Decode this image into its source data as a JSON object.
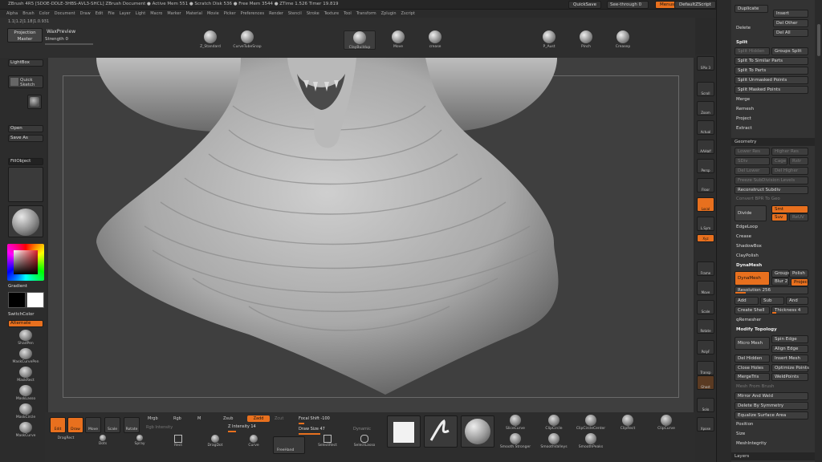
{
  "titlebar": {
    "title": "ZBrush 4R5 [SDOE-DDLE-3HBS-AVL3-SHCL]   ZBrush Document    ● Active Mem 551 ● Scratch Disk 536 ● Free Mem 3544 ● ZTime 1.526 Timer 19.819",
    "quicksave": "QuickSave",
    "seethrough": "See-through  0",
    "menus": "Menus",
    "defaultscript": "DefaultZScript"
  },
  "menus": [
    "Alpha",
    "Brush",
    "Color",
    "Document",
    "Draw",
    "Edit",
    "File",
    "Layer",
    "Light",
    "Macro",
    "Marker",
    "Material",
    "Movie",
    "Picker",
    "Preferences",
    "Render",
    "Stencil",
    "Stroke",
    "Texture",
    "Tool",
    "Transform",
    "Zplugin",
    "Zscript"
  ],
  "toolbar": {
    "coords": "1.1|1.2|1.18|1.0.931",
    "projection_master": "Projection Master",
    "waxpreview": "WaxPreview",
    "strength": "Strength 0",
    "brushes_left": [
      "Z_Standard",
      "CurveTubeSnap"
    ],
    "brushes_right": [
      "ClayBuildup",
      "Move",
      "crease",
      "P_Aust",
      "Pinch",
      "Creasep"
    ]
  },
  "leftshelf": {
    "lightbox": "LightBox",
    "quick_sketch": "Quick Sketch",
    "open": "Open",
    "save_as": "Save As",
    "fill_object": "FillObject",
    "gradient": "Gradient",
    "switch_color": "SwitchColor",
    "alternate": "Alternate",
    "brushes": [
      "ShadPen",
      "MaskCurvePen",
      "MaskRect",
      "MaskLasso",
      "MaskCircle",
      "MaskCurve"
    ]
  },
  "bottomshelf": {
    "edit": "Edit",
    "draw": "Draw",
    "move": "Move",
    "scale": "Scale",
    "rotate": "Rotate",
    "mrgb": "Mrgb",
    "rgb": "Rgb",
    "m": "M",
    "rgb_intensity": "Rgb Intensity",
    "zsub": "Zsub",
    "zadd": "Zadd",
    "zcut": "Zcut",
    "z_intensity": "Z Intensity 14",
    "z_intensity_value": 14,
    "focal_shift": "Focal Shift -100",
    "draw_size": "Draw Size 47",
    "dynamic": "Dynamic",
    "strokes": [
      "DragRect",
      "Dots",
      "Spray"
    ],
    "tools2": [
      "Rect",
      "DragDot",
      "Curve",
      "FreeHand",
      "SelectRect",
      "SelectLasso"
    ],
    "right_icons": [
      "SliceCurve",
      "ClipCircle",
      "ClipCircleCenter",
      "ClipRect",
      "ClipCurve"
    ],
    "right_icons2": [
      "Smooth Stronger",
      "SmoothValleys",
      "SmoothPeaks"
    ]
  },
  "rightshelf": [
    "SPix 3",
    "Scroll",
    "Zoom",
    "Actual",
    "AAHalf",
    "Persp",
    "Floor",
    "Local",
    "L.Sym",
    "Xyz",
    "Frame",
    "Move",
    "Scale",
    "Rotate",
    "PolyF",
    "Transp",
    "Ghost",
    "Solo",
    "Xpose"
  ],
  "rightpanel": {
    "top": [
      "Duplicate",
      "Insert",
      "Delete",
      "Del Other",
      "Del All"
    ],
    "split_head": "Split",
    "split_items": [
      "Split Hidden",
      "Groups Split",
      "Split To Similar Parts",
      "Split To Parts",
      "Split Unmasked Points",
      "Split Masked Points"
    ],
    "merge": "Merge",
    "remesh": "Remesh",
    "project": "Project",
    "extract": "Extract",
    "geometry": "Geometry",
    "geo_dis": [
      "Lower Res",
      "Higher Res",
      "SDiv",
      "Cage",
      "Rstr",
      "Del Lower",
      "Del Higher",
      "Freeze SubDivision Levels"
    ],
    "reconstruct": "Reconstruct Subdiv",
    "convert_bpr": "Convert BPR To Geo",
    "divide": "Divide",
    "smt": "Smt",
    "suv": "Suv",
    "reuv": "ReUV",
    "edgeloop": "EdgeLoop",
    "crease": "Crease",
    "shadowbox": "ShadowBox",
    "claypolish": "ClayPolish",
    "dynamesh_head": "DynaMesh",
    "dynamesh_btn": "DynaMesh",
    "groups": "Groups",
    "polish": "Polish",
    "blur": "Blur 2",
    "project2": "Project",
    "resolution": "Resolution 256",
    "add": "Add",
    "sub": "Sub",
    "and": "And",
    "create_shell": "Create Shell",
    "thickness": "Thickness 4",
    "qremesher": "qRemesher",
    "modify_topology": "Modify Topology",
    "micro_mesh": "Micro Mesh",
    "spin_edge": "Spin Edge",
    "align_edge": "Align Edge",
    "del_hidden": "Del Hidden",
    "insert_mesh": "Insert Mesh",
    "close_holes": "Close Holes",
    "optimize": "Optimize Points",
    "mergetris": "MergeTris",
    "weldpoints": "WeldPoints",
    "mesh_extract": "Mesh From Brush",
    "mirror_weld": "Mirror And Weld",
    "delete_sym": "Delete By Symmetry",
    "equalize": "Equalize Surface Area",
    "position": "Position",
    "size": "Size",
    "meshintegrity": "MeshIntegrity",
    "layers": "Layers"
  },
  "colors": {
    "accent": "#e8701e",
    "panel": "#333333",
    "canvas": "#3f3f3f"
  }
}
